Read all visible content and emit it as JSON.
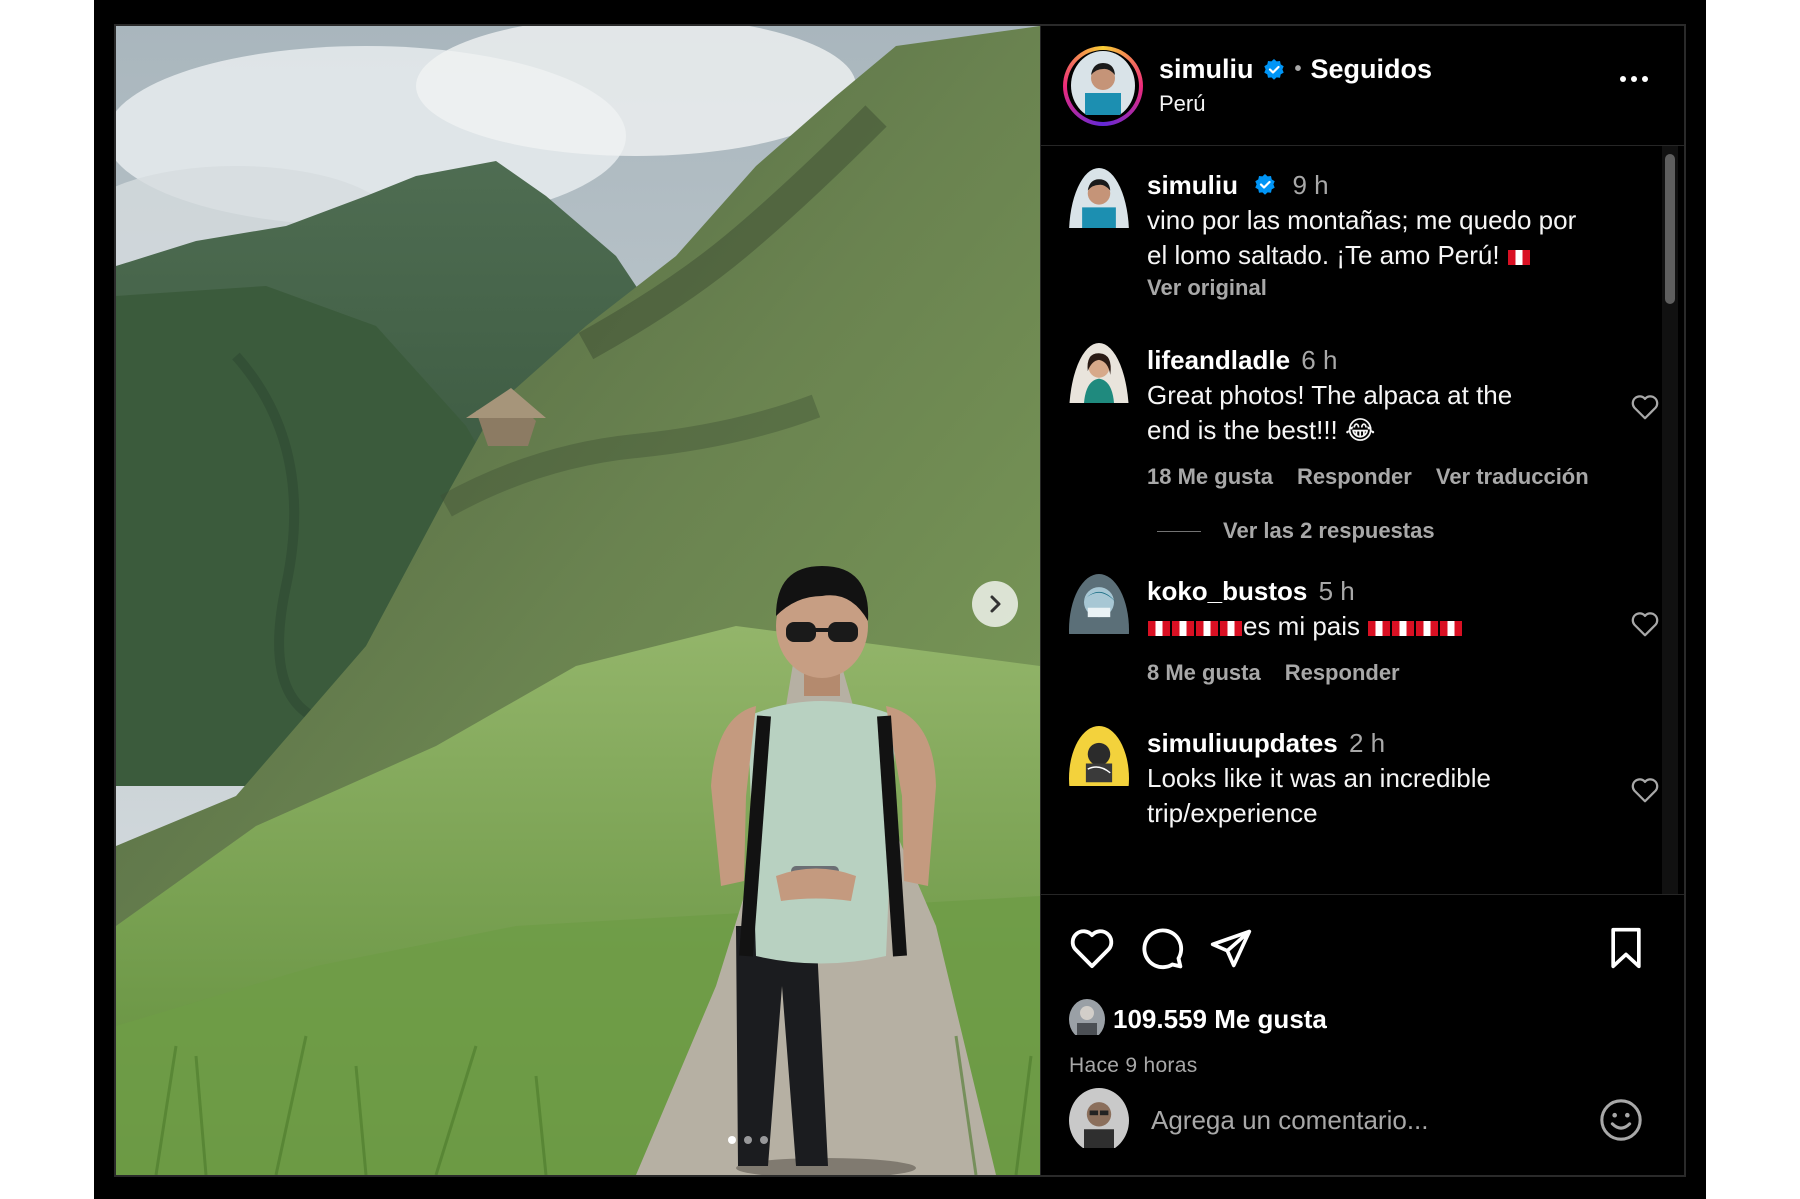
{
  "post": {
    "username": "simuliu",
    "follow_state": "Seguidos",
    "separator": "•",
    "location": "Perú",
    "more_icon": "more-horizontal-icon"
  },
  "comments": [
    {
      "username": "simuliu",
      "time": "9 h",
      "verified": true,
      "text_line1": "vino por las montañas; me quedo por",
      "text_line2": "el lomo saltado. ¡Te amo Perú!",
      "see_original": "Ver original"
    },
    {
      "username": "lifeandladle",
      "time": "6 h",
      "text_line1": "Great photos! The alpaca at the",
      "text_line2": "end is the best!!! 😂",
      "likes": "18 Me gusta",
      "reply": "Responder",
      "translate": "Ver traducción",
      "view_replies": "Ver las 2 respuestas"
    },
    {
      "username": "koko_bustos",
      "time": "5 h",
      "text": "es mi pais",
      "likes": "8 Me gusta",
      "reply": "Responder"
    },
    {
      "username": "simuliuupdates",
      "time": "2 h",
      "text_line1": "Looks like it was an incredible",
      "text_line2": "trip/experience"
    }
  ],
  "actions": {
    "likes": "109.559 Me gusta",
    "time_ago": "Hace 9 horas",
    "comment_placeholder": "Agrega un comentario..."
  },
  "colors": {
    "background": "#000000",
    "verified_blue": "#0095f6",
    "muted_text": "#a8a8a8",
    "peru_red": "#d91023"
  },
  "carousel": {
    "slide_count": 3,
    "active_index": 0
  }
}
